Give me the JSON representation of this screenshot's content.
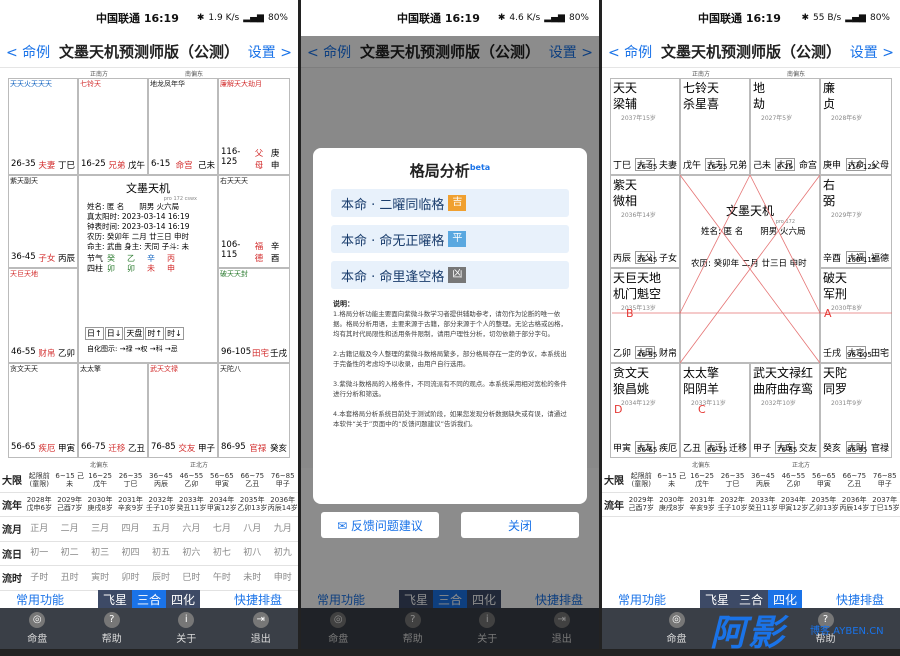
{
  "status": {
    "carrier": "中国联通 16:19",
    "speed": [
      "1.9 K/s",
      "4.6 K/s",
      "55 B/s"
    ],
    "battery": "80%"
  },
  "header": {
    "back": "< 命例",
    "title": "文墨天机预测师版（公测）",
    "settings": "设置 >"
  },
  "directions": {
    "top_left": "正南方",
    "top_right": "南偏东",
    "bottom_left": "北偏东",
    "bottom_right": "正北方"
  },
  "chart_palaces": [
    {
      "stars": "天天火天天天",
      "sub": "",
      "age": "26-35",
      "name": "夫妻",
      "gz": "丁巳"
    },
    {
      "stars": "七铃天",
      "age": "16-25",
      "name": "兄弟",
      "gz": "戊午"
    },
    {
      "stars": "地龙凤年华",
      "age": "6-15",
      "name": "命宫",
      "gz": "己未"
    },
    {
      "stars": "廉解天大劫月",
      "age": "116-125",
      "name": "父母",
      "gz": "庚申"
    },
    {
      "stars": "紫天副天",
      "age": "36-45",
      "name": "子女",
      "gz": "丙辰"
    },
    {
      "stars": "右天天天",
      "age": "106-115",
      "name": "福德",
      "gz": "辛酉"
    },
    {
      "stars": "天巨天地",
      "age": "46-55",
      "name": "财帛",
      "gz": "乙卯"
    },
    {
      "stars": "破天天封",
      "age": "96-105",
      "name": "田宅",
      "gz": "壬戌"
    },
    {
      "stars": "贪文天天",
      "age": "56-65",
      "name": "疾厄",
      "gz": "甲寅"
    },
    {
      "stars": "太太擎",
      "age": "66-75",
      "name": "迁移",
      "gz": "乙丑"
    },
    {
      "stars": "武天文禄",
      "age": "76-85",
      "name": "交友",
      "gz": "甲子"
    },
    {
      "stars": "天陀八",
      "age": "86-95",
      "name": "官禄",
      "gz": "癸亥"
    }
  ],
  "center": {
    "title": "文墨天机",
    "ver": "pro 172 cswx",
    "lines": [
      "姓名: 匿 名　　阴男 火六局",
      "真太阳时: 2023-03-14 16:19",
      "钟表时间: 2023-03-14 16:19",
      "农历: 癸卯年 二月 廿三日 申时",
      "命主: 武曲 身主: 天同 子斗: 未"
    ],
    "pillars": [
      "节气",
      "癸",
      "乙",
      "辛",
      "丙",
      "四柱",
      "卯",
      "卯",
      "未",
      "申"
    ],
    "toggles": [
      "日↑",
      "日↓",
      "天盘",
      "时↑",
      "时↓"
    ],
    "flags": "自化图示: →禄 →权 →科 →忌"
  },
  "fate_rows": {
    "daxian": {
      "label": "大限",
      "cells": [
        "起限前(童限)",
        "6~15 己未",
        "16~25 戊午",
        "26~35 丁巳",
        "36~45 丙辰",
        "46~55 乙卯",
        "56~65 甲寅",
        "66~75 乙丑",
        "76~85 甲子"
      ]
    },
    "liunian": {
      "label": "流年",
      "cells": [
        "2028年戊申6岁",
        "2029年己酉7岁",
        "2030年庚戌8岁",
        "2031年辛亥9岁",
        "2032年壬子10岁",
        "2033年癸丑11岁",
        "2034年甲寅12岁",
        "2035年乙卯13岁",
        "2036年丙辰14岁",
        "2037年丁巳15岁"
      ]
    },
    "liuyue": {
      "label": "流月",
      "cells": [
        "正月",
        "二月",
        "三月",
        "四月",
        "五月",
        "六月",
        "七月",
        "八月",
        "九月"
      ]
    },
    "liuri": {
      "label": "流日",
      "cells": [
        "初一",
        "初二",
        "初三",
        "初四",
        "初五",
        "初六",
        "初七",
        "初八",
        "初九"
      ]
    },
    "liushi": {
      "label": "流时",
      "cells": [
        "子时",
        "丑时",
        "寅时",
        "卯时",
        "辰时",
        "巳时",
        "午时",
        "未时",
        "申时"
      ]
    }
  },
  "tools": {
    "left": "常用功能",
    "tabs": [
      "飞星",
      "三合",
      "四化"
    ],
    "right": "快捷排盘"
  },
  "nav": [
    {
      "label": "命盘",
      "icon": "chart-icon"
    },
    {
      "label": "帮助",
      "icon": "help-icon"
    },
    {
      "label": "关于",
      "icon": "info-icon"
    },
    {
      "label": "退出",
      "icon": "exit-icon"
    }
  ],
  "dialog": {
    "title": "格局分析",
    "beta": "beta",
    "patterns": [
      {
        "text": "本命 · 二曜同临格",
        "tag": "吉",
        "color": "#f0a030"
      },
      {
        "text": "本命 · 命无正曜格",
        "tag": "平",
        "color": "#5aa8e0"
      },
      {
        "text": "本命 · 命里逢空格",
        "tag": "凶",
        "color": "#777777"
      }
    ],
    "note_head": "说明：",
    "notes": [
      "1.格局分析功能主要面向紫微斗数学习者提供辅助参考，请勿作为论断的唯一依据。格局分析用语，主要来源于古籍，部分来源于个人的整理。无论古格或凶格，均有其时代局限性和适用条件限制，请用户理性分析，切勿依赖于部分字句。",
      "2.古籍记载及今人整理的紫微斗数格局繁多，部分格局存在一定的争议，本系统出于完备性的考虑均予以收录，由用户自行选用。",
      "3.紫微斗数格局的入格条件，不同流派有不同的观点。本系统采用相对宽松的条件进行分析和筛选。",
      "4.本套格局分析系统目前处于测试阶段，如果您发现分析数据缺失或有误，请通过本软件“关于”页面中的“反馈问题建议”告诉我们。"
    ],
    "btn_feedback": "✉ 反馈问题建议",
    "btn_close": "关闭"
  },
  "panel3": {
    "palaces": [
      {
        "stars": [
          "天天",
          "梁辅"
        ],
        "stars2": [
          "天火天",
          "钺星马"
        ],
        "age": "26-35",
        "name": "夫妻",
        "gz": "丁巳",
        "year": "2037年15岁"
      },
      {
        "stars": [
          "七铃天",
          "杀星喜"
        ],
        "age": "16-25",
        "name": "兄弟",
        "gz": "戊午",
        "year": ""
      },
      {
        "stars": [
          "地",
          "劫"
        ],
        "age": "6-15",
        "name": "命宫",
        "gz": "己未",
        "year": "2027年5岁"
      },
      {
        "stars": [
          "廉",
          "贞"
        ],
        "age": "116-125",
        "name": "父母",
        "gz": "庚申",
        "year": "2028年6岁"
      },
      {
        "stars": [
          "紫天",
          "微相"
        ],
        "age": "36-45",
        "name": "子女",
        "gz": "丙辰",
        "year": "2036年14岁"
      },
      {
        "stars": [
          "右",
          "弼"
        ],
        "age": "106-115",
        "name": "福德",
        "gz": "辛酉",
        "year": "2029年7岁"
      },
      {
        "stars": [
          "天巨天地",
          "机门魁空"
        ],
        "age": "46-55",
        "name": "财帛",
        "gz": "乙卯",
        "year": "2035年13岁"
      },
      {
        "stars": [
          "破天",
          "军刑"
        ],
        "age": "96-105",
        "name": "田宅",
        "gz": "壬戌",
        "year": "2030年8岁"
      },
      {
        "stars": [
          "贪文天",
          "狼昌姚"
        ],
        "age": "56-65",
        "name": "疾厄",
        "gz": "甲寅",
        "year": "2034年12岁"
      },
      {
        "stars": [
          "太太擎",
          "阳阴羊"
        ],
        "age": "66-75",
        "name": "迁移",
        "gz": "乙丑",
        "year": "2033年11岁"
      },
      {
        "stars": [
          "武天文禄红",
          "曲府曲存鸾"
        ],
        "age": "76-85",
        "name": "交友",
        "gz": "甲子",
        "year": "2032年10岁"
      },
      {
        "stars": [
          "天陀",
          "同罗"
        ],
        "age": "86-95",
        "name": "官禄",
        "gz": "癸亥",
        "year": "2031年9岁"
      }
    ],
    "center_title": "文墨天机",
    "center_ver": "pro 172",
    "center_line1": "姓名: 匿 名　　阴男 火六局",
    "center_line2": "农历: 癸卯年 二月 廿三日 申时",
    "dz_labels": [
      "大子",
      "大夫",
      "大兄",
      "大命",
      "大父",
      "大福",
      "大田",
      "大官",
      "大友",
      "大迁",
      "大疾",
      "大财"
    ],
    "marks": [
      "A",
      "B",
      "C",
      "D"
    ]
  },
  "watermark": {
    "main": "阿影",
    "sub": "博客 AYBEN.CN"
  }
}
